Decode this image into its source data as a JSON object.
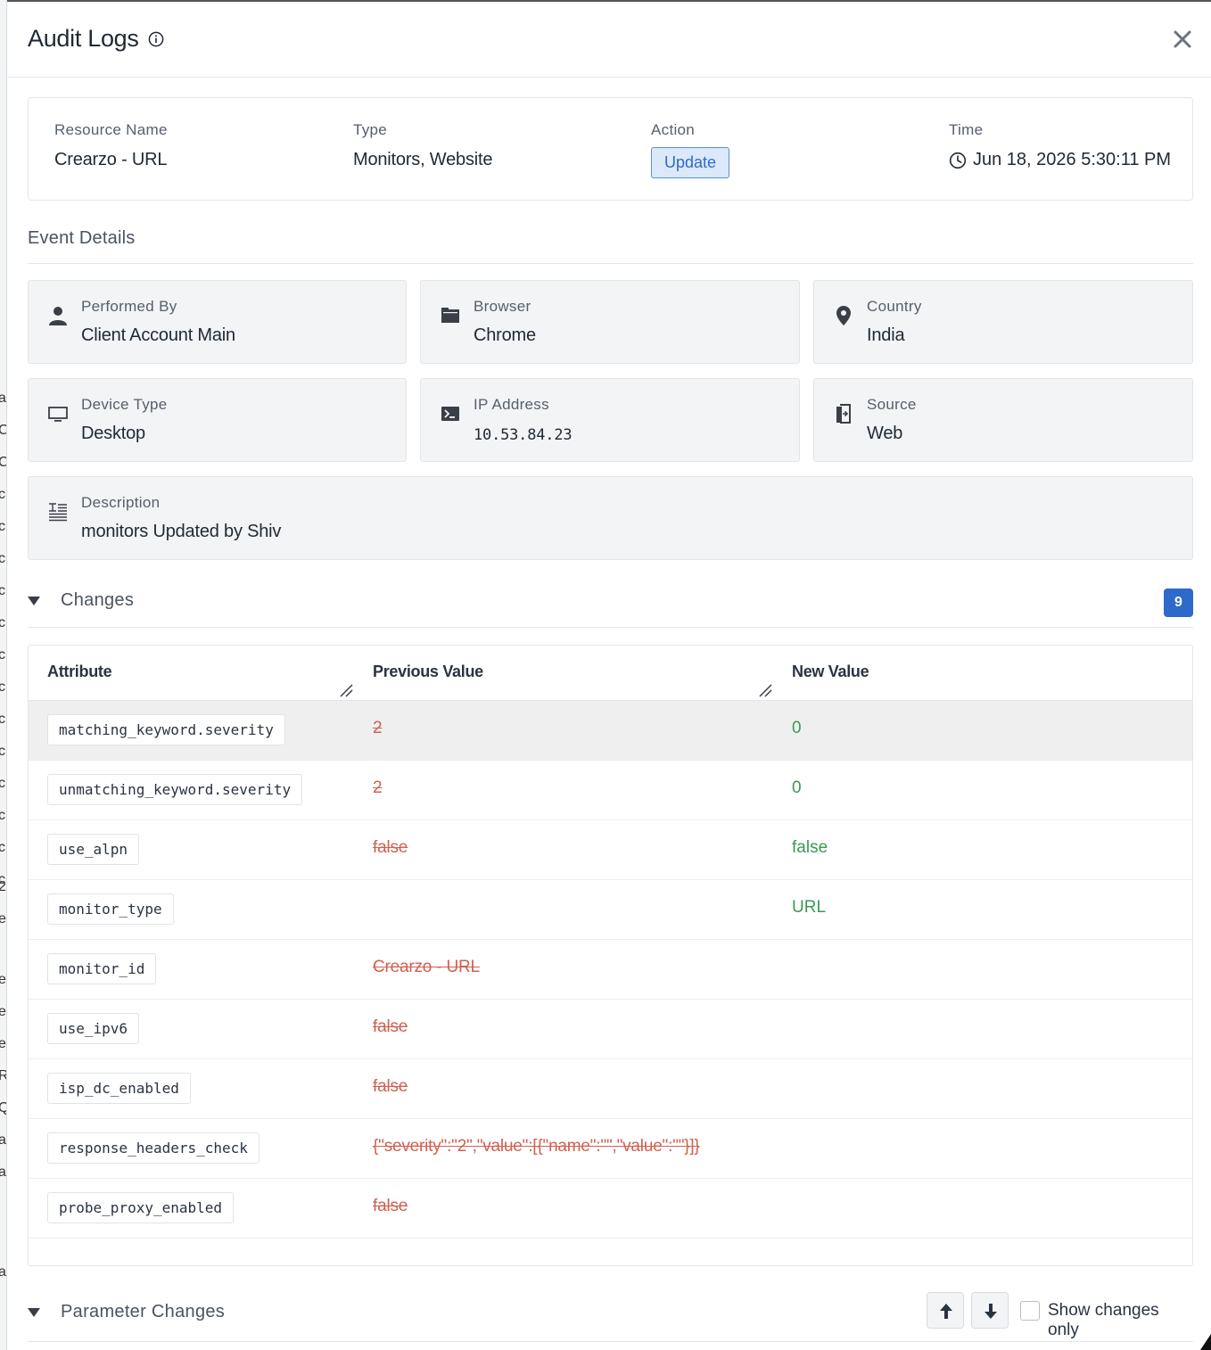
{
  "background_letters": [
    "a",
    "C",
    "C",
    "c",
    "c",
    "c",
    "c",
    "c",
    "c",
    "c",
    "c",
    "c",
    "c",
    "c",
    "c",
    "c",
    "2",
    "e",
    "e",
    "e",
    "e",
    "R",
    "Q",
    "a",
    "a",
    "a"
  ],
  "header": {
    "title": "Audit Logs"
  },
  "summary": {
    "resource_name_label": "Resource Name",
    "resource_name": "Crearzo - URL",
    "type_label": "Type",
    "type": "Monitors, Website",
    "action_label": "Action",
    "action": "Update",
    "time_label": "Time",
    "time": "Jun 18, 2026 5:30:11 PM"
  },
  "event_details": {
    "title": "Event Details",
    "cards": [
      {
        "label": "Performed By",
        "value": "Client Account Main",
        "icon": "user-icon"
      },
      {
        "label": "Browser",
        "value": "Chrome",
        "icon": "browser-icon"
      },
      {
        "label": "Country",
        "value": "India",
        "icon": "location-pin-icon"
      },
      {
        "label": "Device Type",
        "value": "Desktop",
        "icon": "monitor-icon"
      },
      {
        "label": "IP Address",
        "value": "10.53.84.23",
        "icon": "terminal-icon"
      },
      {
        "label": "Source",
        "value": "Web",
        "icon": "login-icon"
      },
      {
        "label": "Description",
        "value": "monitors Updated by Shiv",
        "icon": "description-icon"
      }
    ]
  },
  "changes": {
    "title": "Changes",
    "count": "9",
    "columns": [
      "Attribute",
      "Previous Value",
      "New Value"
    ],
    "rows": [
      {
        "attribute": "matching_keyword.severity",
        "previous": "2",
        "new": "0"
      },
      {
        "attribute": "unmatching_keyword.severity",
        "previous": "2",
        "new": "0"
      },
      {
        "attribute": "use_alpn",
        "previous": "false",
        "new": "false"
      },
      {
        "attribute": "monitor_type",
        "previous": "",
        "new": "URL"
      },
      {
        "attribute": "monitor_id",
        "previous": "Crearzo - URL",
        "new": ""
      },
      {
        "attribute": "use_ipv6",
        "previous": "false",
        "new": ""
      },
      {
        "attribute": "isp_dc_enabled",
        "previous": "false",
        "new": ""
      },
      {
        "attribute": "response_headers_check",
        "previous": "{\"severity\":\"2\",\"value\":[{\"name\":\"\",\"value\":\"\"}]}",
        "new": ""
      },
      {
        "attribute": "probe_proxy_enabled",
        "previous": "false",
        "new": ""
      }
    ]
  },
  "parameter_changes": {
    "title": "Parameter Changes",
    "show_changes_only_label": "Show changes only",
    "show_changes_only_checked": false
  },
  "colors": {
    "accent": "#2d6ac9",
    "removed": "#d06050",
    "added": "#3a9a55",
    "badge_bg": "#dce9fb"
  }
}
